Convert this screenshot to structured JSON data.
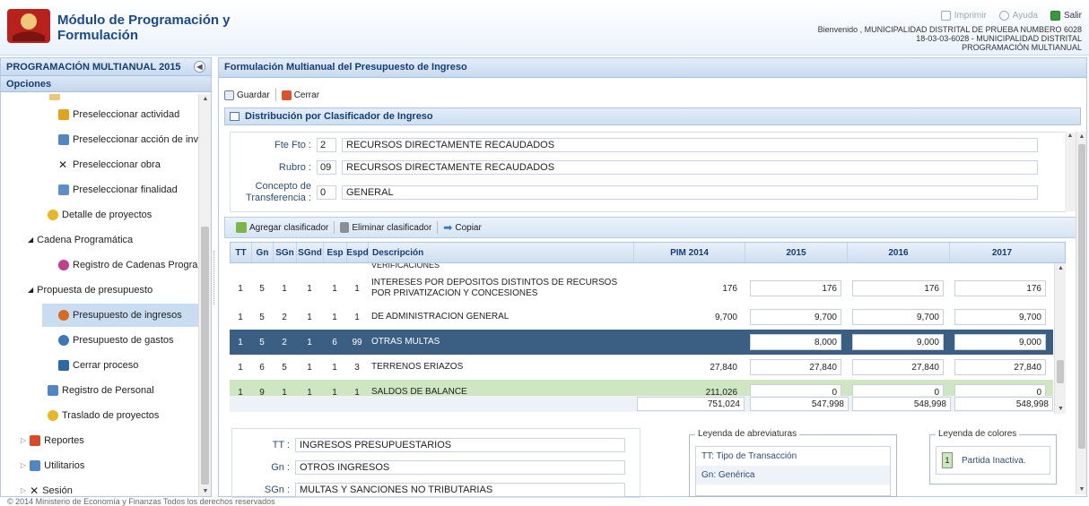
{
  "app": {
    "title": "Módulo de Programación y Formulación",
    "actions": {
      "print": "Imprimir",
      "help": "Ayuda",
      "exit": "Salir"
    },
    "welcome_lines": [
      "Bienvenido , MUNICIPALIDAD DISTRITAL DE PRUEBA NUMBERO 6028",
      "18-03-03-6028 - MUNICIPALIDAD DISTRITAL",
      "PROGRAMACIÓN MULTIANUAL"
    ],
    "footer": "© 2014 Ministerio de Economía y Finanzas Todos los derechos reservados"
  },
  "sidebar": {
    "title": "PROGRAMACIÓN MULTIANUAL 2015",
    "options_label": "Opciones",
    "items": [
      {
        "label": "Preseleccionar actividad",
        "icon": "activity-icon",
        "color": "#e0a41a"
      },
      {
        "label": "Preseleccionar acción de invers",
        "icon": "investment-icon",
        "color": "#4f86c6"
      },
      {
        "label": "Preseleccionar obra",
        "icon": "tools-icon",
        "color": "#444444"
      },
      {
        "label": "Preseleccionar finalidad",
        "icon": "target-icon",
        "color": "#5e8ec9"
      },
      {
        "label": "Detalle de proyectos",
        "icon": "folder-icon",
        "color": "#e8b726"
      },
      {
        "label": "Cadena Programática",
        "icon": "caret-down-icon",
        "color": "#555555"
      },
      {
        "label": "Registro de Cadenas Programá",
        "icon": "chain-icon",
        "color": "#c33f8b"
      },
      {
        "label": "Propuesta de presupuesto",
        "icon": "caret-down-icon",
        "color": "#555555"
      },
      {
        "label": "Presupuesto de ingresos",
        "icon": "income-icon",
        "color": "#d96b1e"
      },
      {
        "label": "Presupuesto de gastos",
        "icon": "expense-icon",
        "color": "#3b78b8"
      },
      {
        "label": "Cerrar proceso",
        "icon": "lock-icon",
        "color": "#2c6aa6"
      },
      {
        "label": "Registro de Personal",
        "icon": "personnel-icon",
        "color": "#4f86c6"
      },
      {
        "label": "Traslado de proyectos",
        "icon": "folder-icon",
        "color": "#e8b726"
      },
      {
        "label": "Reportes",
        "icon": "reports-icon",
        "color": "#d84a2a"
      },
      {
        "label": "Utilitarios",
        "icon": "utilities-icon",
        "color": "#4f86c6"
      },
      {
        "label": "Sesión",
        "icon": "session-icon",
        "color": "#444444"
      }
    ]
  },
  "main": {
    "title": "Formulación Multianual del Presupuesto de Ingreso",
    "toolbar": {
      "save": "Guardar",
      "close": "Cerrar"
    },
    "section_title": "Distribución por Clasificador de Ingreso",
    "form": {
      "fte_label": "Fte Fto :",
      "fte_code": "2",
      "fte_name": "RECURSOS DIRECTAMENTE RECAUDADOS",
      "rubro_label": "Rubro :",
      "rubro_code": "09",
      "rubro_name": "RECURSOS DIRECTAMENTE RECAUDADOS",
      "concepto_label_1": "Concepto de",
      "concepto_label_2": "Transferencia :",
      "concepto_code": "0",
      "concepto_name": "GENERAL"
    },
    "actions": {
      "add": "Agregar clasificador",
      "remove": "Eliminar clasificador",
      "copy": "Copiar"
    },
    "columns": [
      "TT",
      "Gn",
      "SGn",
      "SGnd",
      "Esp",
      "Espd",
      "Descripción",
      "PIM 2014",
      "2015",
      "2016",
      "2017"
    ],
    "partial_row": "VERIFICACIONES",
    "rows": [
      {
        "tt": "1",
        "gn": "5",
        "sgn": "1",
        "sgnd": "1",
        "esp": "1",
        "espd": "1",
        "desc": "INTERESES POR DEPOSITOS DISTINTOS DE RECURSOS POR PRIVATIZACION Y CONCESIONES",
        "pim": "176",
        "y2015": "176",
        "y2016": "176",
        "y2017": "176",
        "style": "normal"
      },
      {
        "tt": "1",
        "gn": "5",
        "sgn": "2",
        "sgnd": "1",
        "esp": "1",
        "espd": "1",
        "desc": "DE ADMINISTRACION GENERAL",
        "pim": "9,700",
        "y2015": "9,700",
        "y2016": "9,700",
        "y2017": "9,700",
        "style": "normal"
      },
      {
        "tt": "1",
        "gn": "5",
        "sgn": "2",
        "sgnd": "1",
        "esp": "6",
        "espd": "99",
        "desc": "OTRAS MULTAS",
        "pim": "",
        "y2015": "8,000",
        "y2016": "9,000",
        "y2017": "9,000",
        "style": "selected"
      },
      {
        "tt": "1",
        "gn": "6",
        "sgn": "5",
        "sgnd": "1",
        "esp": "1",
        "espd": "3",
        "desc": "TERRENOS ERIAZOS",
        "pim": "27,840",
        "y2015": "27,840",
        "y2016": "27,840",
        "y2017": "27,840",
        "style": "normal"
      },
      {
        "tt": "1",
        "gn": "9",
        "sgn": "1",
        "sgnd": "1",
        "esp": "1",
        "espd": "1",
        "desc": "SALDOS DE BALANCE",
        "pim": "211,026",
        "y2015": "0",
        "y2016": "0",
        "y2017": "0",
        "style": "inactive"
      }
    ],
    "totals": {
      "pim": "751,024",
      "y2015": "547,998",
      "y2016": "548,998",
      "y2017": "548,998"
    },
    "detail": [
      {
        "label": "TT :",
        "value": "INGRESOS PRESUPUESTARIOS"
      },
      {
        "label": "Gn :",
        "value": "OTROS INGRESOS"
      },
      {
        "label": "SGn :",
        "value": "MULTAS Y SANCIONES NO TRIBUTARIAS"
      }
    ],
    "legend_abbrev": {
      "title": "Leyenda de abreviaturas",
      "items": [
        "TT: Tipo de Transacción",
        "Gn: Genérica"
      ]
    },
    "legend_colors": {
      "title": "Leyenda de colores",
      "swatch": "1",
      "label": "Partida Inactiva."
    },
    "colors": {
      "selected": "#3b5f83",
      "inactive": "#cfe6c2",
      "brand": "#1a4a8a"
    }
  }
}
